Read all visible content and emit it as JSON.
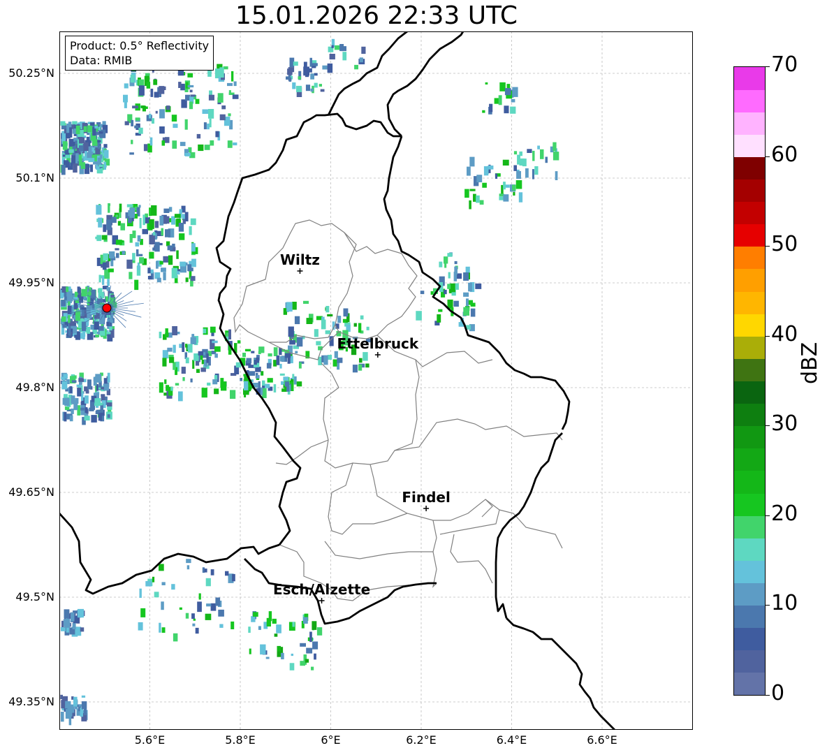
{
  "title": "15.01.2026 22:33 UTC",
  "info": {
    "product": "Product: 0.5° Reflectivity",
    "data": "Data: RMIB"
  },
  "lat_labels": [
    "50.25°N",
    "50.1°N",
    "49.95°N",
    "49.8°N",
    "49.65°N",
    "49.5°N",
    "49.35°N"
  ],
  "lon_labels": [
    "5.6°E",
    "5.8°E",
    "6°E",
    "6.2°E",
    "6.4°E",
    "6.6°E"
  ],
  "cities": [
    {
      "name": "Wiltz",
      "lat": 49.967,
      "lon": 5.932
    },
    {
      "name": "Ettelbruck",
      "lat": 49.847,
      "lon": 6.104
    },
    {
      "name": "Findel",
      "lat": 49.627,
      "lon": 6.211
    },
    {
      "name": "Esch/Alzette",
      "lat": 49.495,
      "lon": 5.98
    }
  ],
  "radar_site": {
    "lat": 49.914,
    "lon": 5.505,
    "color": "#ff0000"
  },
  "colorbar": {
    "label": "dBZ",
    "ticks": [
      "0",
      "10",
      "20",
      "30",
      "40",
      "50",
      "60",
      "70"
    ],
    "colors": [
      "#6373a8",
      "#50639e",
      "#3f5c9f",
      "#4b78ae",
      "#5d9cc5",
      "#64c2db",
      "#5ed8c1",
      "#41d46b",
      "#16c620",
      "#14b718",
      "#13a815",
      "#119812",
      "#0e7f10",
      "#0a6510",
      "#3f7412",
      "#aaae08",
      "#ffd700",
      "#ffb600",
      "#ff9f00",
      "#ff7e00",
      "#e60000",
      "#c30000",
      "#a40000",
      "#7f0000",
      "#ffe0ff",
      "#ffb3ff",
      "#ff6bff",
      "#e93ae9"
    ]
  }
}
